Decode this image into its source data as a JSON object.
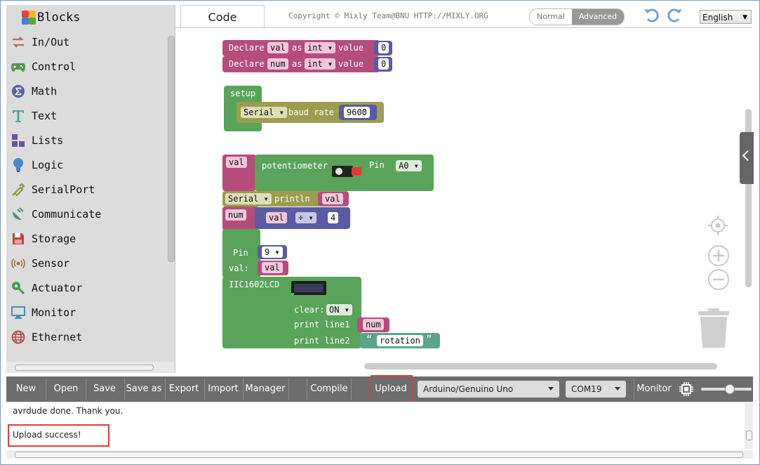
{
  "sidebar": {
    "title": "Blocks",
    "categories": [
      {
        "label": "In/Out",
        "icon": "arrows-icon"
      },
      {
        "label": "Control",
        "icon": "gamepad-icon"
      },
      {
        "label": "Math",
        "icon": "math-icon"
      },
      {
        "label": "Text",
        "icon": "text-icon"
      },
      {
        "label": "Lists",
        "icon": "lists-icon"
      },
      {
        "label": "Logic",
        "icon": "bulb-icon"
      },
      {
        "label": "SerialPort",
        "icon": "serial-icon"
      },
      {
        "label": "Communicate",
        "icon": "satellite-icon"
      },
      {
        "label": "Storage",
        "icon": "storage-icon"
      },
      {
        "label": "Sensor",
        "icon": "sensor-icon"
      },
      {
        "label": "Actuator",
        "icon": "actuator-icon"
      },
      {
        "label": "Monitor",
        "icon": "monitor-icon"
      },
      {
        "label": "Ethernet",
        "icon": "globe-icon"
      }
    ]
  },
  "header": {
    "tab_code": "Code",
    "copyright": "Copyright © Mixly Team@BNU HTTP://MIXLY.ORG",
    "mode_normal": "Normal",
    "mode_advanced": "Advanced",
    "language": "English"
  },
  "blocks": {
    "declare1": {
      "kw": "Declare",
      "var": "val",
      "as": "as",
      "type": "int",
      "value_kw": "value",
      "value": "0"
    },
    "declare2": {
      "kw": "Declare",
      "var": "num",
      "as": "as",
      "type": "int",
      "value_kw": "value",
      "value": "0"
    },
    "setup": {
      "kw": "setup",
      "serial": "Serial",
      "baud": "baud rate",
      "baud_value": "9600"
    },
    "pot": {
      "var": "val",
      "label": "potentiometer",
      "pin_kw": "Pin",
      "pin": "A0"
    },
    "println": {
      "serial": "Serial",
      "kw": "println",
      "var": "val"
    },
    "num_assign": {
      "var": "num",
      "lhs": "val",
      "op": "÷",
      "rhs": "4"
    },
    "servo": {
      "pin_kw": "Pin",
      "pin": "9",
      "val_kw": "val:",
      "val": "val"
    },
    "lcd": {
      "label": "IIC1602LCD",
      "clear_kw": "clear:",
      "clear": "ON",
      "line1_kw": "print line1",
      "line1": "num",
      "line2_kw": "print line2",
      "line2": "rotation",
      "open_quote": "“",
      "close_quote": "”"
    }
  },
  "toolbar": {
    "new": "New",
    "open": "Open",
    "save": "Save",
    "save_as": "Save as",
    "export": "Export",
    "import": "Import",
    "manager": "Manager",
    "compile": "Compile",
    "upload": "Upload",
    "board": "Arduino/Genuino Uno",
    "port": "COM19",
    "monitor": "Monitor"
  },
  "console": {
    "line1": "avrdude done.  Thank you.",
    "line2": "Upload success!"
  }
}
